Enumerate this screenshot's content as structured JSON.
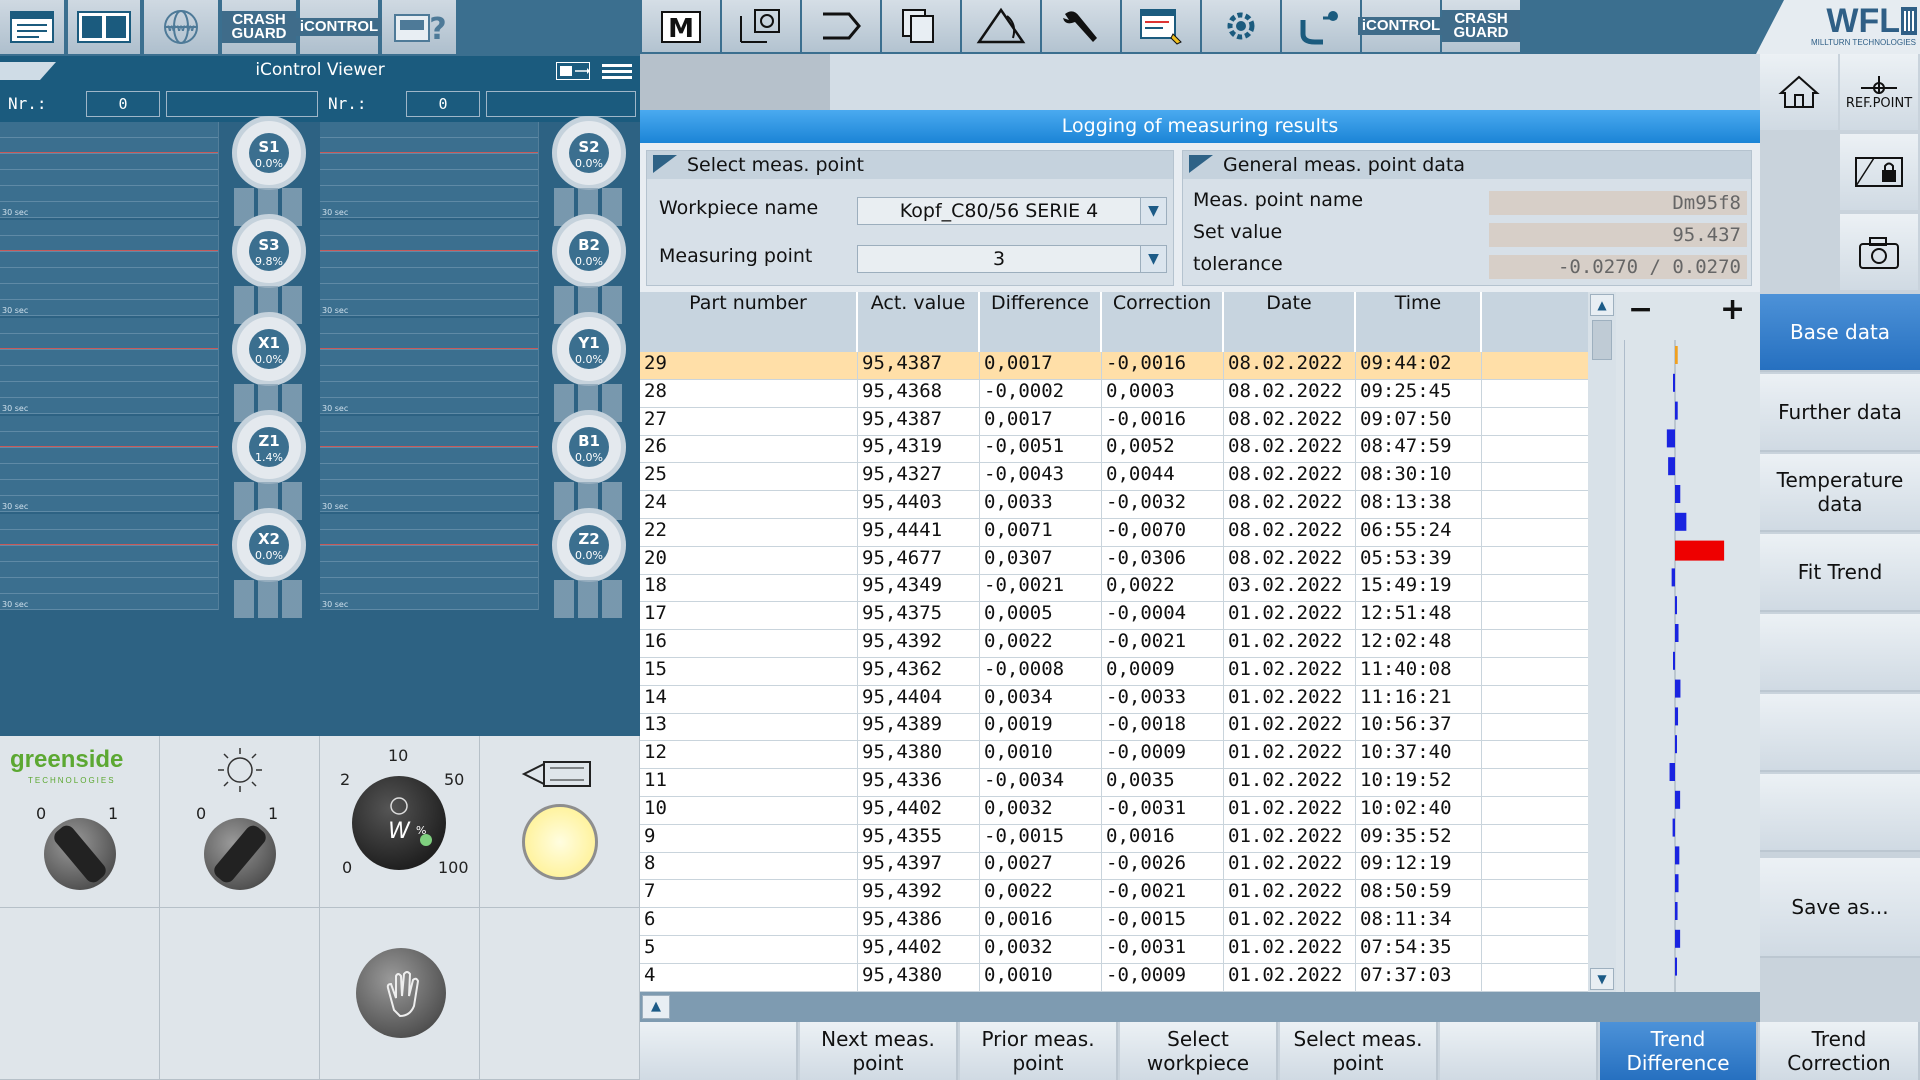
{
  "left_toolbar": {
    "crash_guard": "CRASH GUARD",
    "icontrol": "iCONTROL"
  },
  "viewer": {
    "title": "iControl Viewer",
    "nr_label_1": "Nr.:",
    "nr_value_1": "0",
    "nr_label_2": "Nr.:",
    "nr_value_2": "0",
    "sec_label": "30 sec"
  },
  "gauges": [
    {
      "label": "S1",
      "pct": "0.0%"
    },
    {
      "label": "S2",
      "pct": "0.0%"
    },
    {
      "label": "S3",
      "pct": "9.8%"
    },
    {
      "label": "B2",
      "pct": "0.0%"
    },
    {
      "label": "X1",
      "pct": "0.0%"
    },
    {
      "label": "Y1",
      "pct": "0.0%"
    },
    {
      "label": "Z1",
      "pct": "1.4%"
    },
    {
      "label": "B1",
      "pct": "0.0%"
    },
    {
      "label": "X2",
      "pct": "0.0%"
    },
    {
      "label": "Z2",
      "pct": "0.0%"
    }
  ],
  "controls": {
    "greenside_name": "greenside",
    "greenside_sub": "TECHNOLOGIES",
    "sw1_min": "0",
    "sw1_max": "1",
    "sw2_min": "0",
    "sw2_max": "1",
    "dial_10": "10",
    "dial_2": "2",
    "dial_50": "50",
    "dial_0": "0",
    "dial_100": "100",
    "dial_symbol": "W%"
  },
  "top_toolbar": {
    "m_label": "M",
    "icontrol": "iCONTROL",
    "crash_guard": "CRASH GUARD"
  },
  "brand": {
    "name": "WFL",
    "sub": "MILLTURN TECHNOLOGIES"
  },
  "main": {
    "title": "Logging of measuring results",
    "select_panel": {
      "title": "Select meas. point",
      "workpiece_label": "Workpiece name",
      "workpiece_value": "Kopf_C80/56 SERIE 4",
      "measpoint_label": "Measuring point",
      "measpoint_value": "3"
    },
    "general_panel": {
      "title": "General meas. point data",
      "name_label": "Meas. point name",
      "name_value": "Dm95f8",
      "set_label": "Set value",
      "set_value": "95.437",
      "tol_label": "tolerance",
      "tol_value": "-0.0270 / 0.0270"
    },
    "columns": [
      "Part number",
      "Act. value",
      "Difference",
      "Correction",
      "Date",
      "Time"
    ],
    "rows": [
      [
        "29",
        "95,4387",
        "0,0017",
        "-0,0016",
        "08.02.2022",
        "09:44:02"
      ],
      [
        "28",
        "95,4368",
        "-0,0002",
        "0,0003",
        "08.02.2022",
        "09:25:45"
      ],
      [
        "27",
        "95,4387",
        "0,0017",
        "-0,0016",
        "08.02.2022",
        "09:07:50"
      ],
      [
        "26",
        "95,4319",
        "-0,0051",
        "0,0052",
        "08.02.2022",
        "08:47:59"
      ],
      [
        "25",
        "95,4327",
        "-0,0043",
        "0,0044",
        "08.02.2022",
        "08:30:10"
      ],
      [
        "24",
        "95,4403",
        "0,0033",
        "-0,0032",
        "08.02.2022",
        "08:13:38"
      ],
      [
        "22",
        "95,4441",
        "0,0071",
        "-0,0070",
        "08.02.2022",
        "06:55:24"
      ],
      [
        "20",
        "95,4677",
        "0,0307",
        "-0,0306",
        "08.02.2022",
        "05:53:39"
      ],
      [
        "18",
        "95,4349",
        "-0,0021",
        "0,0022",
        "03.02.2022",
        "15:49:19"
      ],
      [
        "17",
        "95,4375",
        "0,0005",
        "-0,0004",
        "01.02.2022",
        "12:51:48"
      ],
      [
        "16",
        "95,4392",
        "0,0022",
        "-0,0021",
        "01.02.2022",
        "12:02:48"
      ],
      [
        "15",
        "95,4362",
        "-0,0008",
        "0,0009",
        "01.02.2022",
        "11:40:08"
      ],
      [
        "14",
        "95,4404",
        "0,0034",
        "-0,0033",
        "01.02.2022",
        "11:16:21"
      ],
      [
        "13",
        "95,4389",
        "0,0019",
        "-0,0018",
        "01.02.2022",
        "10:56:37"
      ],
      [
        "12",
        "95,4380",
        "0,0010",
        "-0,0009",
        "01.02.2022",
        "10:37:40"
      ],
      [
        "11",
        "95,4336",
        "-0,0034",
        "0,0035",
        "01.02.2022",
        "10:19:52"
      ],
      [
        "10",
        "95,4402",
        "0,0032",
        "-0,0031",
        "01.02.2022",
        "10:02:40"
      ],
      [
        "9",
        "95,4355",
        "-0,0015",
        "0,0016",
        "01.02.2022",
        "09:35:52"
      ],
      [
        "8",
        "95,4397",
        "0,0027",
        "-0,0026",
        "01.02.2022",
        "09:12:19"
      ],
      [
        "7",
        "95,4392",
        "0,0022",
        "-0,0021",
        "01.02.2022",
        "08:50:59"
      ],
      [
        "6",
        "95,4386",
        "0,0016",
        "-0,0015",
        "01.02.2022",
        "08:11:34"
      ],
      [
        "5",
        "95,4402",
        "0,0032",
        "-0,0031",
        "01.02.2022",
        "07:54:35"
      ],
      [
        "4",
        "95,4380",
        "0,0010",
        "-0,0009",
        "01.02.2022",
        "07:37:03"
      ]
    ],
    "selected_row": 0,
    "trend": {
      "minus": "−",
      "plus": "+"
    }
  },
  "right_bar": {
    "home_icon": "home-icon",
    "refpoint_label": "REF.POINT",
    "buttons": [
      "Base data",
      "Further data",
      "Temperature data",
      "Fit Trend",
      "",
      "",
      "",
      "Save as..."
    ],
    "active": 0
  },
  "bottom_bar": {
    "buttons": [
      "",
      "Next meas. point",
      "Prior meas. point",
      "Select workpiece",
      "Select meas. point",
      "",
      "Trend Difference",
      "Trend Correction"
    ],
    "active": 6
  },
  "colors": {
    "accent": "#2670c0",
    "title_bar": "#1b84d6",
    "selected_row": "#ffdfa8",
    "bar_normal": "#1a24e0",
    "bar_selected": "#f0a020",
    "bar_out": "#ee0000",
    "toolbar": "#3b6f8f"
  }
}
